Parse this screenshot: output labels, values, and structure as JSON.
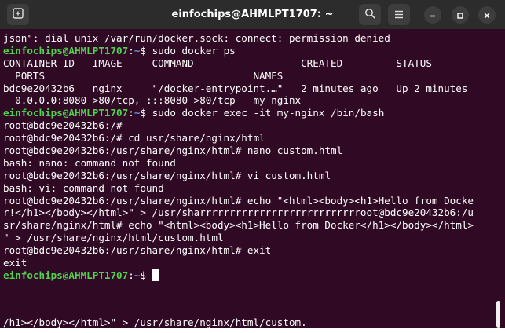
{
  "window": {
    "title": "einfochips@AHMLPT1707: ~",
    "icons": {
      "new_tab": "new-tab-icon",
      "search": "search-icon",
      "menu": "hamburger-menu-icon",
      "minimize": "minimize-icon",
      "maximize": "maximize-icon",
      "close": "close-icon"
    }
  },
  "terminal": {
    "colors": {
      "background": "#300a24",
      "user": "#4fd34f",
      "path": "#6b8fd8",
      "text": "#ffffff"
    },
    "lines": [
      {
        "kind": "out",
        "text": "json\": dial unix /var/run/docker.sock: connect: permission denied"
      },
      {
        "kind": "prompt",
        "user": "einfochips@AHMLPT1707",
        "path": "~",
        "cmd": "$ sudo docker ps"
      },
      {
        "kind": "out",
        "text": "CONTAINER ID   IMAGE     COMMAND                  CREATED         STATUS"
      },
      {
        "kind": "out",
        "text": "  PORTS                                   NAMES"
      },
      {
        "kind": "out",
        "text": "bdc9e20432b6   nginx     \"/docker-entrypoint.…\"   2 minutes ago   Up 2 minutes"
      },
      {
        "kind": "out",
        "text": "  0.0.0.0:8080->80/tcp, :::8080->80/tcp   my-nginx"
      },
      {
        "kind": "prompt",
        "user": "einfochips@AHMLPT1707",
        "path": "~",
        "cmd": "$ sudo docker exec -it my-nginx /bin/bash"
      },
      {
        "kind": "out",
        "text": "root@bdc9e20432b6:/#"
      },
      {
        "kind": "out",
        "text": "root@bdc9e20432b6:/# cd usr/share/nginx/html"
      },
      {
        "kind": "out",
        "text": "root@bdc9e20432b6:/usr/share/nginx/html# nano custom.html"
      },
      {
        "kind": "out",
        "text": "bash: nano: command not found"
      },
      {
        "kind": "out",
        "text": "root@bdc9e20432b6:/usr/share/nginx/html# vi custom.html"
      },
      {
        "kind": "out",
        "text": "bash: vi: command not found"
      },
      {
        "kind": "out",
        "text": "root@bdc9e20432b6:/usr/share/nginx/html# echo \"<html><body><h1>Hello from Docke"
      },
      {
        "kind": "out",
        "text": "r!</h1></body></html>\" > /usr/sharrrrrrrrrrrrrrrrrrrrrrrrrrroot@bdc9e20432b6:/u"
      },
      {
        "kind": "out",
        "text": "sr/share/nginx/html# echo \"<html><body><h1>Hello from Docker</h1></body></html>"
      },
      {
        "kind": "out",
        "text": "\" > /usr/share/nginx/html/custom.html"
      },
      {
        "kind": "out",
        "text": "root@bdc9e20432b6:/usr/share/nginx/html# exit"
      },
      {
        "kind": "out",
        "text": "exit"
      },
      {
        "kind": "prompt",
        "user": "einfochips@AHMLPT1707",
        "path": "~",
        "cmd": "$ ",
        "cursor": true
      }
    ],
    "bottom_line": "/h1></body></html>\" > /usr/share/nginx/html/custom."
  }
}
